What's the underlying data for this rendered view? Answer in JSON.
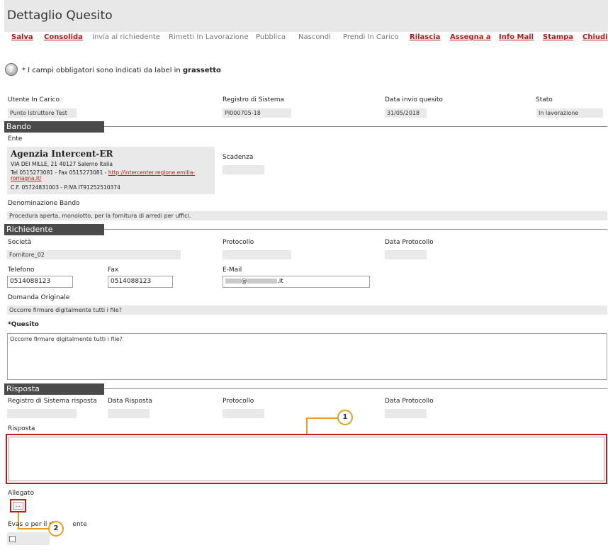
{
  "page": {
    "title": "Dettaglio Quesito"
  },
  "toolbar": {
    "salva": "Salva",
    "consolida": "Consolida",
    "invia": "Invia al richiedente",
    "rimetti": "Rimetti In Lavorazione",
    "pubblica": "Pubblica",
    "nascondi": "Nascondi",
    "prendi": "Prendi In Carico",
    "rilascia": "Rilascia",
    "assegna": "Assegna a",
    "info_mail": "Info Mail",
    "stampa": "Stampa",
    "chiudi": "Chiudi"
  },
  "note": {
    "prefix": "* I campi obbligatori sono indicati da label in",
    "bold": "grassetto",
    "help_glyph": "?"
  },
  "header": {
    "utente_label": "Utente In Carico",
    "utente_value": "Punto Istruttore Test",
    "registro_label": "Registro di Sistema",
    "registro_value": "PI000705-18",
    "data_invio_label": "Data invio quesito",
    "data_invio_value": "31/05/2018",
    "stato_label": "Stato",
    "stato_value": "In lavorazione"
  },
  "bando": {
    "section": "Bando",
    "ente_label": "Ente",
    "ente_name": "Agenzia Intercent-ER",
    "ente_address": "VIA DEI MILLE, 21 40127 Salerno Italia",
    "ente_tel": "Tel 0515273081 - Fax 0515273081 -",
    "ente_link_1": "http://intercenter.regione.emilia-",
    "ente_link_2": "romagna.it/",
    "ente_cf": "C.F. 05724831003 - P.IVA IT91252510374",
    "scadenza_label": "Scadenza",
    "denominazione_label": "Denominazione Bando",
    "denominazione_value": "Procedura aperta, monolotto, per la fornitura di arredi per uffici."
  },
  "richiedente": {
    "section": "Richiedente",
    "societa_label": "Società",
    "societa_value": "Fornitore_02",
    "protocollo_label": "Protocollo",
    "data_protocollo_label": "Data Protocollo",
    "telefono_label": "Telefono",
    "telefono_value": "0514088123",
    "fax_label": "Fax",
    "fax_value": "0514088123",
    "email_label": "E-Mail",
    "email_value": "@",
    "email_domain_suffix": ".it",
    "domanda_label": "Domanda Originale",
    "domanda_value": "Occorre firmare digitalmente tutti i file?",
    "quesito_star": "*",
    "quesito_label": "Quesito",
    "quesito_value": "Occorre firmare digitalmente tutti i file?"
  },
  "risposta": {
    "section": "Risposta",
    "registro_label": "Registro di Sistema risposta",
    "data_label": "Data Risposta",
    "protocollo_label": "Protocollo",
    "data_protocollo_label": "Data Protocollo",
    "risposta_label": "Risposta",
    "risposta_value": "",
    "allegato_label": "Allegato",
    "allegato_button": "...",
    "evaso_label_a": "Evas",
    "evaso_label_b": "o per il ric",
    "evaso_label_c": "ente"
  },
  "callouts": {
    "one": "1",
    "two": "2"
  },
  "colors": {
    "accent_red": "#b01a1a",
    "section_bg": "#4a4a4a",
    "callout_orange": "#e6a020",
    "highlight_red": "#c0181d"
  }
}
